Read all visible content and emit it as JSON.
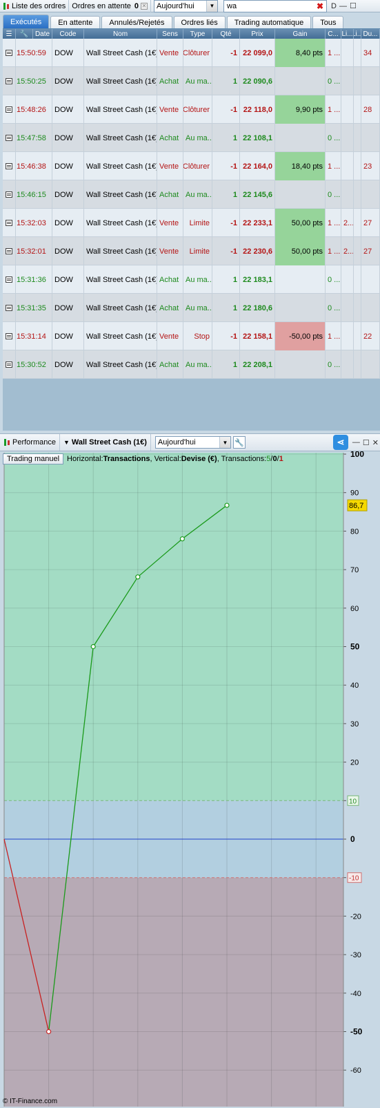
{
  "toolbar": {
    "orders_list_label": "Liste des ordres",
    "pending_label": "Ordres en attente",
    "pending_count": "0",
    "period_value": "Aujourd'hui",
    "search_value": "wa",
    "window_letter": "D",
    "minimize": "—",
    "maximize": "☐",
    "close": "✕"
  },
  "tabs": [
    {
      "label": "Exécutés",
      "active": true
    },
    {
      "label": "En attente"
    },
    {
      "label": "Annulés/Rejetés"
    },
    {
      "label": "Ordres liés"
    },
    {
      "label": "Trading automatique"
    },
    {
      "label": "Tous"
    }
  ],
  "table": {
    "headers": [
      "Date",
      "Code",
      "Nom",
      "Sens",
      "Type",
      "Qté",
      "Prix",
      "Gain",
      "C...",
      "Li...",
      "Li...",
      "Du..."
    ],
    "rows": [
      {
        "time": "15:50:59",
        "code": "DOW",
        "name": "Wall Street Cash (1€)",
        "side": "Vente",
        "type": "Clôturer",
        "qty": "-1",
        "price": "22 099,0",
        "gain": "8,40 pts",
        "gain_state": "pos",
        "c": "1 ...",
        "l1": "",
        "l2": "",
        "du": "34"
      },
      {
        "time": "15:50:25",
        "code": "DOW",
        "name": "Wall Street Cash (1€)",
        "side": "Achat",
        "type": "Au ma...",
        "qty": "1",
        "price": "22 090,6",
        "gain": "",
        "gain_state": "none",
        "c": "0 ...",
        "l1": "",
        "l2": "",
        "du": ""
      },
      {
        "time": "15:48:26",
        "code": "DOW",
        "name": "Wall Street Cash (1€)",
        "side": "Vente",
        "type": "Clôturer",
        "qty": "-1",
        "price": "22 118,0",
        "gain": "9,90 pts",
        "gain_state": "pos",
        "c": "1 ...",
        "l1": "",
        "l2": "",
        "du": "28"
      },
      {
        "time": "15:47:58",
        "code": "DOW",
        "name": "Wall Street Cash (1€)",
        "side": "Achat",
        "type": "Au ma...",
        "qty": "1",
        "price": "22 108,1",
        "gain": "",
        "gain_state": "none",
        "c": "0 ...",
        "l1": "",
        "l2": "",
        "du": ""
      },
      {
        "time": "15:46:38",
        "code": "DOW",
        "name": "Wall Street Cash (1€)",
        "side": "Vente",
        "type": "Clôturer",
        "qty": "-1",
        "price": "22 164,0",
        "gain": "18,40 pts",
        "gain_state": "pos",
        "c": "1 ...",
        "l1": "",
        "l2": "",
        "du": "23"
      },
      {
        "time": "15:46:15",
        "code": "DOW",
        "name": "Wall Street Cash (1€)",
        "side": "Achat",
        "type": "Au ma...",
        "qty": "1",
        "price": "22 145,6",
        "gain": "",
        "gain_state": "none",
        "c": "0 ...",
        "l1": "",
        "l2": "",
        "du": ""
      },
      {
        "time": "15:32:03",
        "code": "DOW",
        "name": "Wall Street Cash (1€)",
        "side": "Vente",
        "type": "Limite",
        "qty": "-1",
        "price": "22 233,1",
        "gain": "50,00 pts",
        "gain_state": "pos",
        "c": "1 ...",
        "l1": "2...",
        "l2": "",
        "du": "27"
      },
      {
        "time": "15:32:01",
        "code": "DOW",
        "name": "Wall Street Cash (1€)",
        "side": "Vente",
        "type": "Limite",
        "qty": "-1",
        "price": "22 230,6",
        "gain": "50,00 pts",
        "gain_state": "pos",
        "c": "1 ...",
        "l1": "2...",
        "l2": "",
        "du": "27"
      },
      {
        "time": "15:31:36",
        "code": "DOW",
        "name": "Wall Street Cash (1€)",
        "side": "Achat",
        "type": "Au ma...",
        "qty": "1",
        "price": "22 183,1",
        "gain": "",
        "gain_state": "none",
        "c": "0 ...",
        "l1": "",
        "l2": "",
        "du": ""
      },
      {
        "time": "15:31:35",
        "code": "DOW",
        "name": "Wall Street Cash (1€)",
        "side": "Achat",
        "type": "Au ma...",
        "qty": "1",
        "price": "22 180,6",
        "gain": "",
        "gain_state": "none",
        "c": "0 ...",
        "l1": "",
        "l2": "",
        "du": ""
      },
      {
        "time": "15:31:14",
        "code": "DOW",
        "name": "Wall Street Cash (1€)",
        "side": "Vente",
        "type": "Stop",
        "qty": "-1",
        "price": "22 158,1",
        "gain": "-50,00 pts",
        "gain_state": "neg",
        "c": "1 ...",
        "l1": "",
        "l2": "",
        "du": "22"
      },
      {
        "time": "15:30:52",
        "code": "DOW",
        "name": "Wall Street Cash (1€)",
        "side": "Achat",
        "type": "Au ma...",
        "qty": "1",
        "price": "22 208,1",
        "gain": "",
        "gain_state": "none",
        "c": "0 ...",
        "l1": "",
        "l2": "",
        "du": ""
      }
    ]
  },
  "performance": {
    "panel_label": "Performance",
    "instrument": "Wall Street Cash (1€)",
    "period_value": "Aujourd'hui",
    "manual_button": "Trading manuel",
    "info_prefix_h": "Horizontal: ",
    "info_h_value": "Transactions",
    "info_prefix_v": ", Vertical: ",
    "info_v_value": "Devise (€)",
    "info_prefix_t": ", Transactions: ",
    "info_t_green": "5",
    "info_t_sep1": " / ",
    "info_t_black": "0",
    "info_t_sep2": " / ",
    "info_t_red": "1",
    "copyright": "© IT-Finance.com"
  },
  "chart_data": {
    "type": "line",
    "x": [
      0,
      1,
      2,
      3,
      4,
      5,
      6
    ],
    "y": [
      0,
      -50,
      50,
      68.1,
      78,
      86.7
    ],
    "last_value_label": "86,7",
    "ylim": [
      -60,
      100
    ],
    "yticks": [
      100,
      90,
      80,
      70,
      60,
      50,
      40,
      30,
      20,
      10,
      0,
      -10,
      -20,
      -30,
      -40,
      -50,
      -60
    ],
    "bold_ticks": [
      100,
      50,
      0,
      -50
    ],
    "threshold_labels": [
      "10",
      "-10"
    ],
    "zones": {
      "profit": "#a3dcc4",
      "neutral": "#b2cfe0",
      "loss": "#b7aab5"
    },
    "colors": {
      "up": "#1a9a1a",
      "down": "#c82020",
      "zero_line": "#2040c8",
      "last_badge": "#f5d800"
    }
  }
}
